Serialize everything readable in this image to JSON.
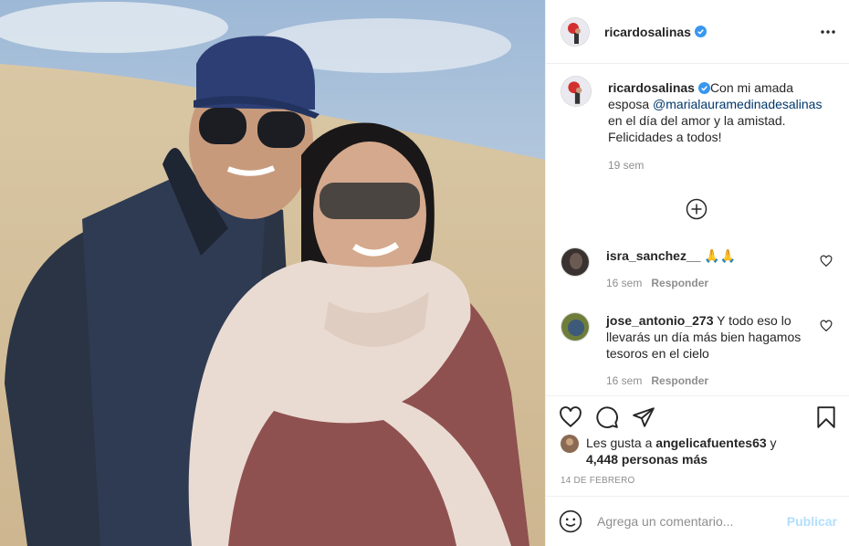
{
  "post": {
    "username": "ricardosalinas",
    "verified": true
  },
  "caption": {
    "username": "ricardosalinas",
    "text_before": "Con mi amada esposa ",
    "mention": "@marialauramedinadesalinas",
    "text_after": " en el día del amor y la amistad. Felicidades a todos!",
    "time": "19 sem"
  },
  "comments": [
    {
      "username": "isra_sanchez__",
      "text": " 🙏🙏",
      "time": "16 sem",
      "reply_label": "Responder"
    },
    {
      "username": "jose_antonio_273",
      "text": " Y todo eso lo llevarás un día más bien hagamos tesoros en el cielo",
      "time": "16 sem",
      "reply_label": "Responder"
    }
  ],
  "likes": {
    "prefix": "Les gusta a ",
    "user": "angelicafuentes63",
    "conjunction": " y ",
    "others": "4,448 personas más"
  },
  "date": "14 DE FEBRERO",
  "add_comment": {
    "placeholder": "Agrega un comentario...",
    "publish_label": "Publicar"
  },
  "colors": {
    "link": "#00376b",
    "verified": "#3897f0",
    "publish_disabled": "#b2dffc",
    "secondary_text": "#8e8e8e"
  },
  "icons": [
    "more-options-icon",
    "verified-badge-icon",
    "load-more-icon",
    "heart-icon",
    "comment-icon",
    "share-icon",
    "bookmark-icon",
    "emoji-icon"
  ]
}
